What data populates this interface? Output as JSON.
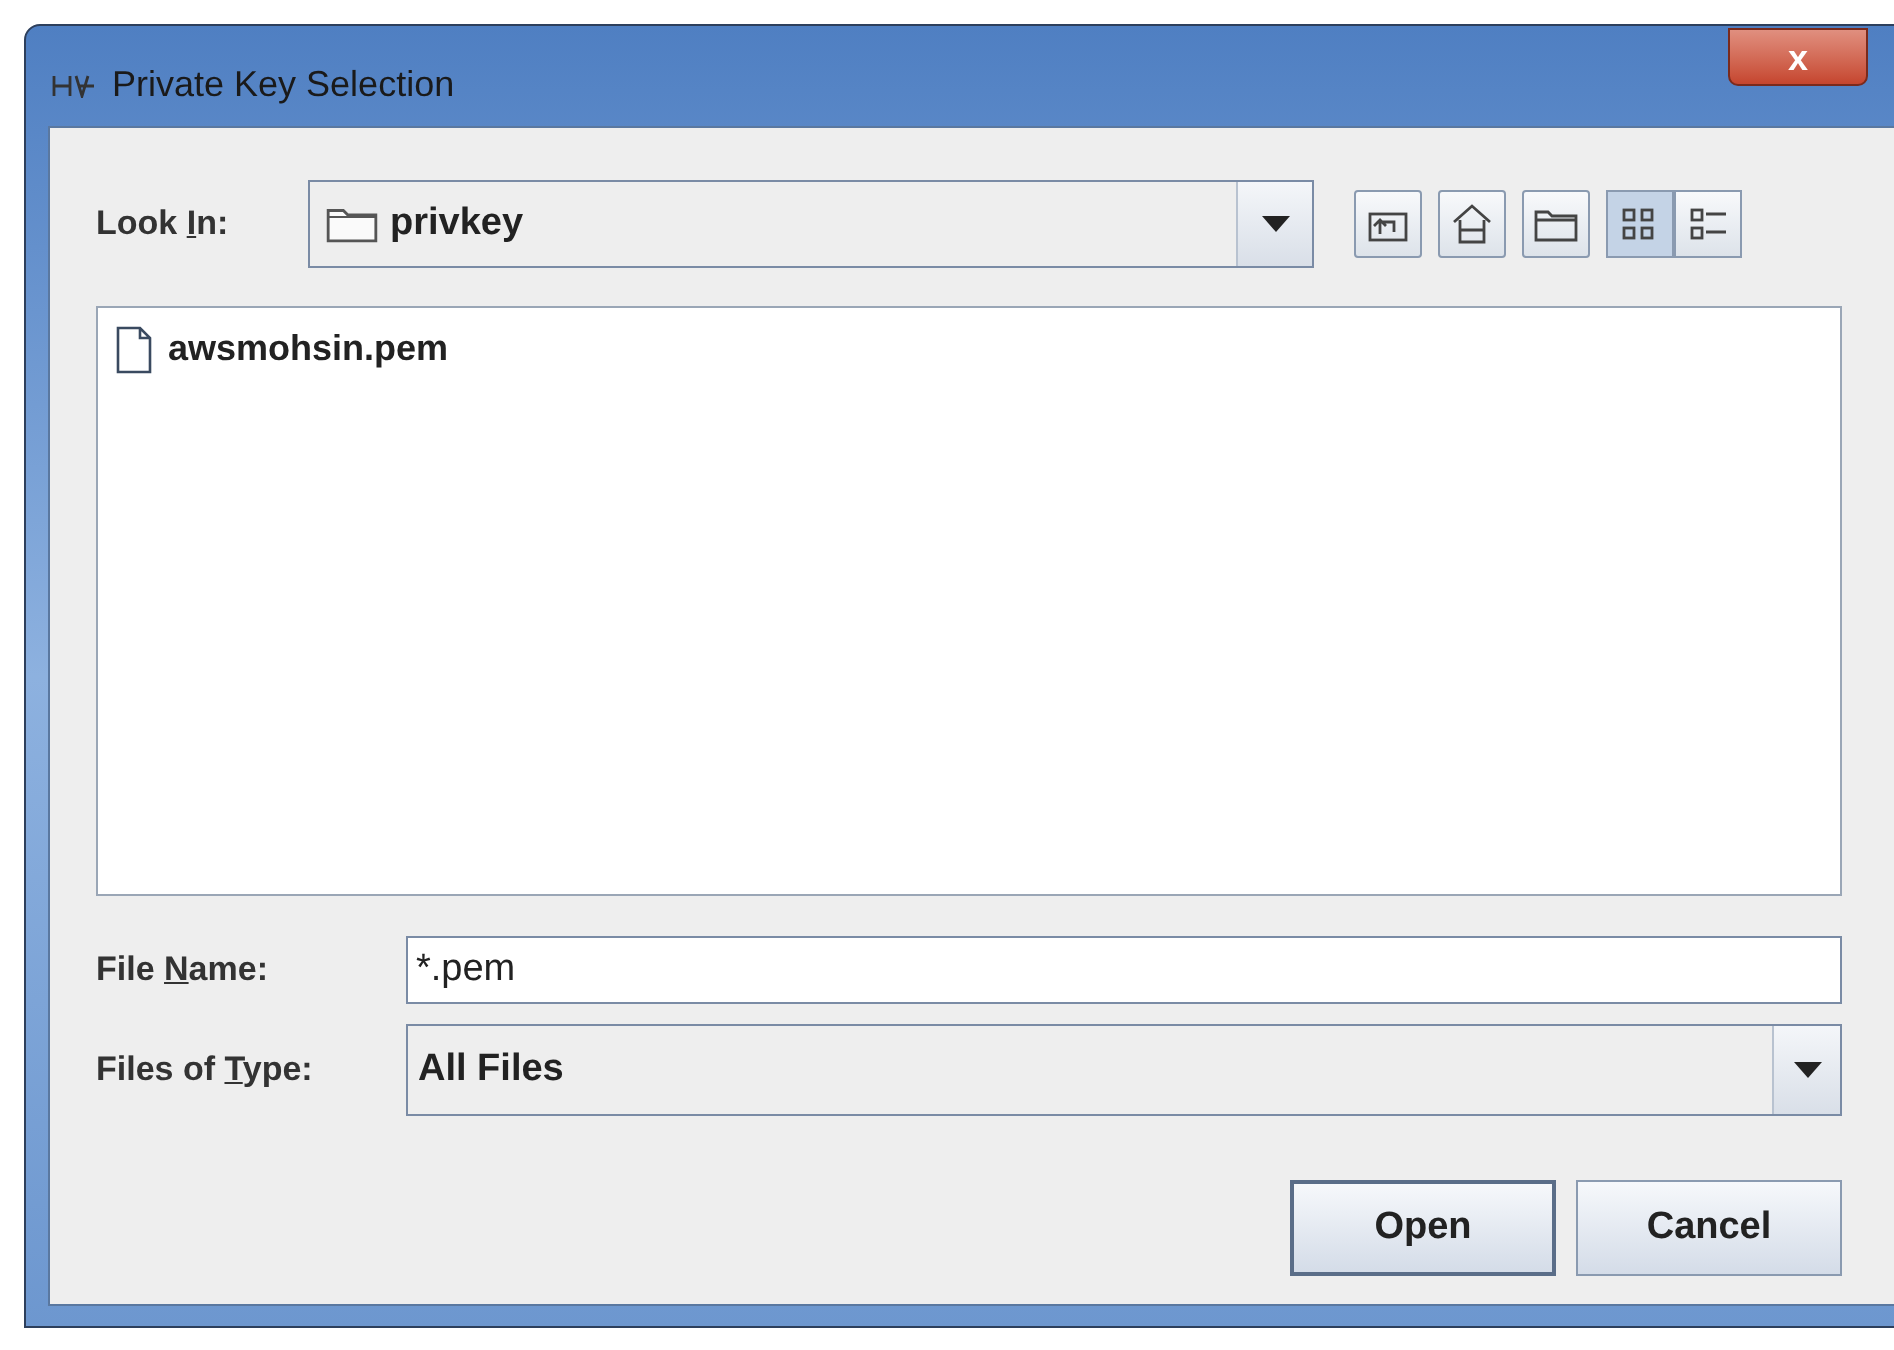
{
  "window": {
    "title": "Private Key Selection",
    "close_label": "x"
  },
  "look_in": {
    "label_parts": [
      "Look ",
      "I",
      "n:"
    ],
    "value": "privkey"
  },
  "toolbar": [
    {
      "kind": "up"
    },
    {
      "kind": "home"
    },
    {
      "kind": "new-folder"
    },
    {
      "kind": "list",
      "selected": true
    },
    {
      "kind": "details",
      "selected": false
    }
  ],
  "files": [
    {
      "name": "awsmohsin.pem",
      "selected": false
    }
  ],
  "file_name": {
    "label_parts": [
      "File ",
      "N",
      "ame:"
    ],
    "value": "*.pem"
  },
  "file_type": {
    "label_parts": [
      "Files of ",
      "T",
      "ype:"
    ],
    "value": "All Files"
  },
  "buttons": [
    {
      "label": "Open",
      "default": true
    },
    {
      "label": "Cancel",
      "default": false
    }
  ]
}
